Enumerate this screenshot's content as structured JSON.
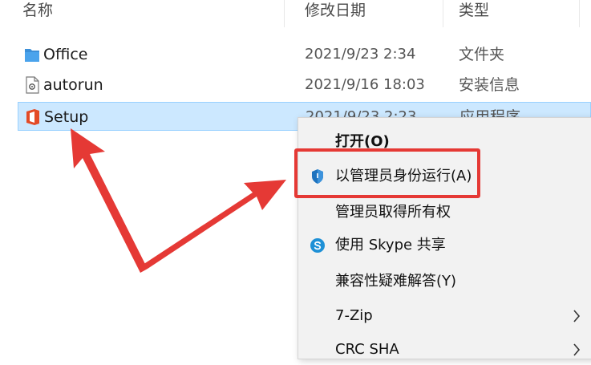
{
  "columns": {
    "name": "名称",
    "date": "修改日期",
    "type": "类型"
  },
  "files": [
    {
      "name": "Office",
      "date": "2021/9/23 2:34",
      "type": "文件夹",
      "icon": "folder-icon"
    },
    {
      "name": "autorun",
      "date": "2021/9/16 18:03",
      "type": "安装信息",
      "icon": "settings-file-icon"
    },
    {
      "name": "Setup",
      "date": "2021/9/23 2:23",
      "type": "应用程序",
      "icon": "office-app-icon",
      "selected": true
    }
  ],
  "context_menu": {
    "items": [
      {
        "label": "打开(O)",
        "bold": true
      },
      {
        "label": "以管理员身份运行(A)",
        "icon": "shield-icon",
        "highlighted": true
      },
      {
        "label": "管理员取得所有权"
      },
      {
        "label": "使用 Skype 共享",
        "icon": "skype-icon"
      },
      {
        "label": "兼容性疑难解答(Y)"
      },
      {
        "label": "7-Zip",
        "submenu": true
      },
      {
        "label": "CRC SHA",
        "submenu": true
      }
    ]
  },
  "colors": {
    "selection": "#cce8ff",
    "folder": "#3b8fd8",
    "office": "#e34a26",
    "shield": "#1e73be",
    "skype": "#1e90d6",
    "annotation": "#e53935"
  }
}
